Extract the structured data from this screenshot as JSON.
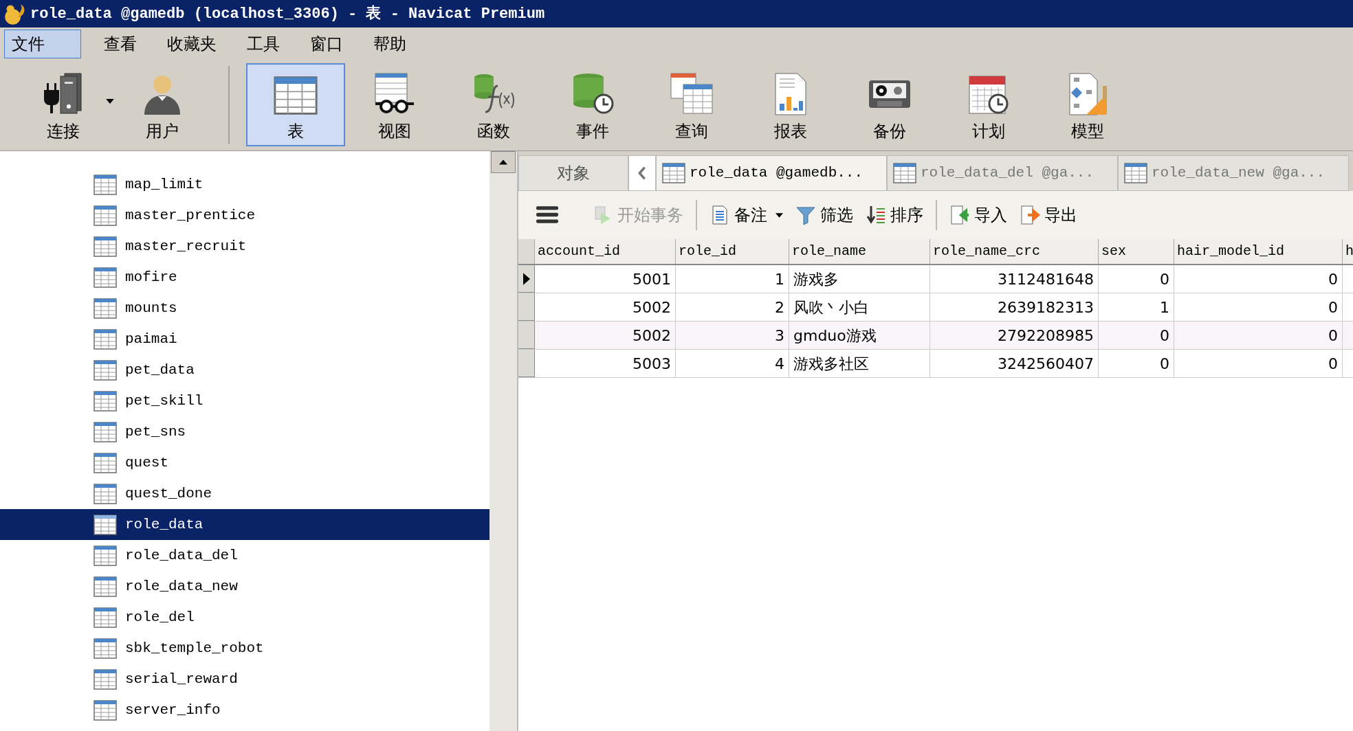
{
  "window": {
    "title": "role_data @gamedb (localhost_3306) - 表 - Navicat Premium"
  },
  "menu": [
    {
      "label": "文件",
      "selected": true
    },
    {
      "label": "查看",
      "selected": false
    },
    {
      "label": "收藏夹",
      "selected": false
    },
    {
      "label": "工具",
      "selected": false
    },
    {
      "label": "窗口",
      "selected": false
    },
    {
      "label": "帮助",
      "selected": false
    }
  ],
  "toolbar": [
    {
      "label": "连接",
      "kind": "connection",
      "selected": false,
      "dropdown": true
    },
    {
      "label": "用户",
      "kind": "user",
      "selected": false,
      "dropdown": false
    },
    {
      "label": "表",
      "kind": "table",
      "selected": true,
      "dropdown": false
    },
    {
      "label": "视图",
      "kind": "view",
      "selected": false,
      "dropdown": false
    },
    {
      "label": "函数",
      "kind": "function",
      "selected": false,
      "dropdown": false
    },
    {
      "label": "事件",
      "kind": "event",
      "selected": false,
      "dropdown": false
    },
    {
      "label": "查询",
      "kind": "query",
      "selected": false,
      "dropdown": false
    },
    {
      "label": "报表",
      "kind": "report",
      "selected": false,
      "dropdown": false
    },
    {
      "label": "备份",
      "kind": "backup",
      "selected": false,
      "dropdown": false
    },
    {
      "label": "计划",
      "kind": "schedule",
      "selected": false,
      "dropdown": false
    },
    {
      "label": "模型",
      "kind": "model",
      "selected": false,
      "dropdown": false
    }
  ],
  "tree": {
    "items": [
      {
        "label": "map_limit",
        "selected": false
      },
      {
        "label": "master_prentice",
        "selected": false
      },
      {
        "label": "master_recruit",
        "selected": false
      },
      {
        "label": "mofire",
        "selected": false
      },
      {
        "label": "mounts",
        "selected": false
      },
      {
        "label": "paimai",
        "selected": false
      },
      {
        "label": "pet_data",
        "selected": false
      },
      {
        "label": "pet_skill",
        "selected": false
      },
      {
        "label": "pet_sns",
        "selected": false
      },
      {
        "label": "quest",
        "selected": false
      },
      {
        "label": "quest_done",
        "selected": false
      },
      {
        "label": "role_data",
        "selected": true
      },
      {
        "label": "role_data_del",
        "selected": false
      },
      {
        "label": "role_data_new",
        "selected": false
      },
      {
        "label": "role_del",
        "selected": false
      },
      {
        "label": "sbk_temple_robot",
        "selected": false
      },
      {
        "label": "serial_reward",
        "selected": false
      },
      {
        "label": "server_info",
        "selected": false
      }
    ]
  },
  "tabs": {
    "objects": "对象",
    "documents": [
      {
        "label": "role_data @gamedb...",
        "selected": true
      },
      {
        "label": "role_data_del @ga...",
        "selected": false
      },
      {
        "label": "role_data_new @ga...",
        "selected": false
      }
    ]
  },
  "data_toolbar": [
    {
      "label": "开始事务",
      "kind": "transaction",
      "disabled": true,
      "dropdown": false
    },
    {
      "label": "备注",
      "kind": "memo",
      "disabled": false,
      "dropdown": true
    },
    {
      "label": "筛选",
      "kind": "filter",
      "disabled": false,
      "dropdown": false
    },
    {
      "label": "排序",
      "kind": "sort",
      "disabled": false,
      "dropdown": false
    },
    {
      "label": "导入",
      "kind": "import",
      "disabled": false,
      "dropdown": false
    },
    {
      "label": "导出",
      "kind": "export",
      "disabled": false,
      "dropdown": false
    }
  ],
  "table": {
    "columns": [
      "account_id",
      "role_id",
      "role_name",
      "role_name_crc",
      "sex",
      "hair_model_id",
      "h"
    ],
    "rows": [
      {
        "selected": true,
        "cells": [
          "5001",
          "1",
          "游戏多",
          "3112481648",
          "0",
          "0"
        ]
      },
      {
        "selected": false,
        "cells": [
          "5002",
          "2",
          "风吹丶小白",
          "2639182313",
          "1",
          "0"
        ]
      },
      {
        "selected": false,
        "cells": [
          "5002",
          "3",
          "gmduo游戏",
          "2792208985",
          "0",
          "0"
        ]
      },
      {
        "selected": false,
        "cells": [
          "5003",
          "4",
          "游戏多社区",
          "3242560407",
          "0",
          "0"
        ]
      }
    ]
  }
}
